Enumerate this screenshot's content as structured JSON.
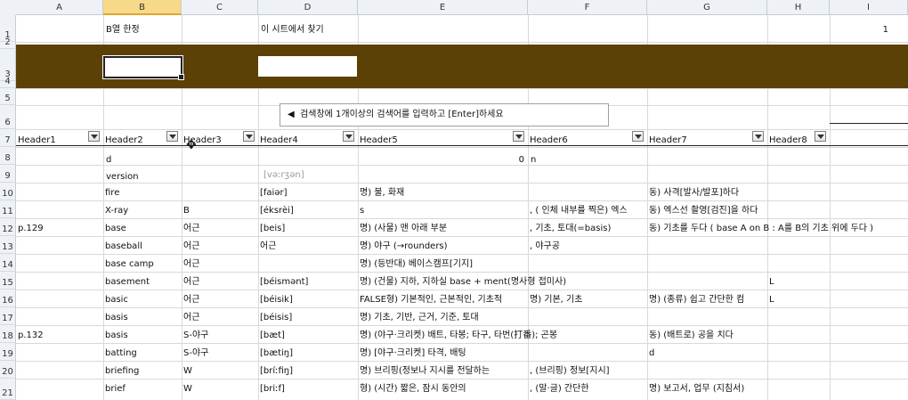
{
  "columns": [
    "A",
    "B",
    "C",
    "D",
    "E",
    "F",
    "G",
    "H",
    "I"
  ],
  "rows": [
    "1",
    "2",
    "3",
    "4",
    "5",
    "6",
    "7",
    "8",
    "9",
    "10",
    "11",
    "12",
    "13",
    "14",
    "15",
    "16",
    "17",
    "18",
    "19",
    "20",
    "21"
  ],
  "labels": {
    "b_only": "B열 한정",
    "find_in_sheet": "이 시트에서 찾기",
    "i1_value": "1"
  },
  "note": {
    "arrow": "◀",
    "text": "검색창에 1개이상의  검색어를 입력하고 [Enter]하세요"
  },
  "headers": [
    "Header1",
    "Header2",
    "Header3",
    "Header4",
    "Header5",
    "Header6",
    "Header7",
    "Header8"
  ],
  "r8": {
    "b": "d",
    "e": "0",
    "f": "n"
  },
  "r9": {
    "b": "version",
    "d": "[vəːrʒən]"
  },
  "data_rows": [
    {
      "a": "",
      "b": "fire",
      "c": "",
      "d": "[faiər]",
      "e": "명) 불, 화재",
      "f": "",
      "g": "동) 사격[발사/발포]하다",
      "h": ""
    },
    {
      "a": "",
      "b": "X-ray",
      "c": "B",
      "d": "[éksrèi]",
      "e": "s",
      "f": ", ( 인체 내부를 찍은) 엑스",
      "g": "동) 엑스선 촬영[검진]을 하다",
      "h": ""
    },
    {
      "a": "p.129",
      "b": "base",
      "c": "어근",
      "d": "[beis]",
      "e": "명) (사물) 맨 아래 부분",
      "f": ", 기초, 토대(=basis)",
      "g": "동) 기초를 두다 ( base A on B : A를 B의 기초 위에 두다 )",
      "h": ""
    },
    {
      "a": "",
      "b": "baseball",
      "c": "어근",
      "d": "어근",
      "e": "명) 야구 (→rounders)",
      "f": ", 야구공",
      "g": "",
      "h": ""
    },
    {
      "a": "",
      "b": "base camp",
      "c": "어근",
      "d": "",
      "e": "명) (등반대) 베이스캠프[기지]",
      "f": "",
      "g": "",
      "h": ""
    },
    {
      "a": "",
      "b": "basement",
      "c": "어근",
      "d": "[béismənt]",
      "e": "명) (건물) 지하, 지하실 base + ment(명사형 접미사)",
      "f": "",
      "g": "",
      "h": "L"
    },
    {
      "a": "",
      "b": "basic",
      "c": "어근",
      "d": "[béisik]",
      "e": "FALSE형) 기본적인, 근본적인, 기초적",
      "f": "명) 기본, 기초",
      "g": "명) (종류) 쉽고 간단한 컴",
      "h": "L"
    },
    {
      "a": "",
      "b": "basis",
      "c": "어근",
      "d": "[béisis]",
      "e": "명) 기초, 기반, 근거, 기준, 토대",
      "f": "",
      "g": "",
      "h": ""
    },
    {
      "a": "p.132",
      "b": "basis",
      "c": "S-야구",
      "d": "[bæt]",
      "e": "명) (야구·크리켓) 배트, 타봉; 타구, 타번(打番); 곤봉",
      "f": "",
      "g": "동) (배트로) 공을 치다",
      "h": ""
    },
    {
      "a": "",
      "b": "batting",
      "c": "S-야구",
      "d": "[bætiŋ]",
      "e": "명) [야구·크리켓] 타격, 배팅",
      "f": "",
      "g": "d",
      "h": ""
    },
    {
      "a": "",
      "b": "briefing",
      "c": "W",
      "d": "[bríːfiŋ]",
      "e": "명) 브리핑(정보나 지시를 전달하는",
      "f": ", (브리핑) 정보[지시]",
      "g": "",
      "h": ""
    },
    {
      "a": "",
      "b": "brief",
      "c": "W",
      "d": "[briːf]",
      "e": "형) (시간) 짧은, 잠시 동안의",
      "f": ", (말·글) 간단한",
      "g": "명) 보고서, 업무 (지침서)",
      "h": ""
    }
  ]
}
